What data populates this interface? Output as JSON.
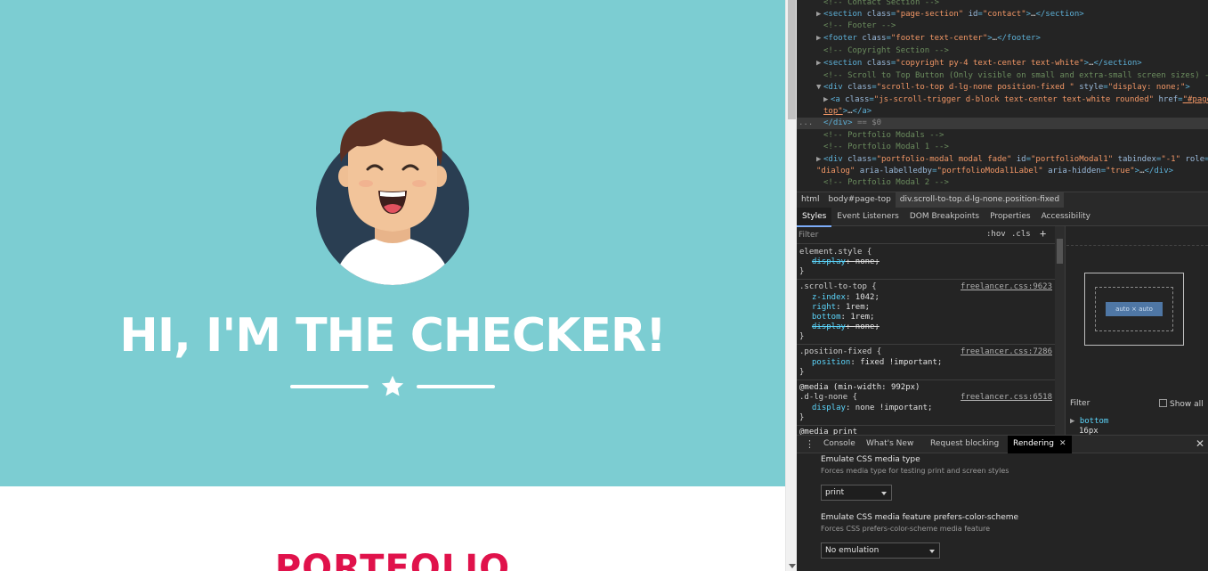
{
  "page": {
    "hero_title": "HI, I'M THE CHECKER!",
    "portfolio_heading": "PORTFOLIO",
    "colors": {
      "masthead": "#7ccdd2",
      "accent": "#e0124b",
      "white": "#ffffff"
    }
  },
  "devtools": {
    "dom": [
      {
        "comment": "<!-- Contact Section -->"
      },
      {
        "tag": "section",
        "attrs": [
          [
            "class",
            "page-section"
          ],
          [
            "id",
            "contact"
          ]
        ],
        "collapsed": "…</section>"
      },
      {
        "comment": "<!-- Footer -->"
      },
      {
        "tag": "footer",
        "attrs": [
          [
            "class",
            "footer text-center"
          ]
        ],
        "collapsed": "…</footer>"
      },
      {
        "comment": "<!-- Copyright Section -->"
      },
      {
        "tag": "section",
        "attrs": [
          [
            "class",
            "copyright py-4 text-center text-white"
          ]
        ],
        "collapsed": "…</section>"
      },
      {
        "comment": "<!-- Scroll to Top Button (Only visible on small and extra-small screen sizes) -->"
      },
      {
        "tag": "div",
        "attrs": [
          [
            "class",
            "scroll-to-top d-lg-none position-fixed "
          ],
          [
            "style",
            "display: none;"
          ]
        ],
        "open": true
      },
      {
        "tag_a_line1": "<a class=\"js-scroll-trigger d-block text-center text-white rounded\" href=\"#page-",
        "tag_a_line2": "top\">…</a>"
      },
      {
        "close": "</div>",
        "marker": "== $0"
      },
      {
        "comment": "<!-- Portfolio Modals -->"
      },
      {
        "comment": "<!-- Portfolio Modal 1 -->"
      },
      {
        "modal_line1": "<div class=\"portfolio-modal modal fade\" id=\"portfolioModal1\" tabindex=\"-1\" role=",
        "modal_line2": "\"dialog\" aria-labelledby=\"portfolioModal1Label\" aria-hidden=\"true\">…</div>"
      },
      {
        "comment": "<!-- Portfolio Modal 2 -->"
      }
    ],
    "dom_text": {
      "l0": "<!-- Contact Section -->",
      "l2": "<!-- Footer -->",
      "l4": "<!-- Copyright Section -->",
      "l6": "<!-- Scroll to Top Button (Only visible on small and extra-small screen sizes) -->",
      "l10": "<!-- Portfolio Modals -->",
      "l11": "<!-- Portfolio Modal 1 -->",
      "l13": "<!-- Portfolio Modal 2 -->",
      "close_div": "</div>",
      "marker": "== $0",
      "ellipsis": "..."
    },
    "breadcrumbs": [
      "html",
      "body#page-top",
      "div.scroll-to-top.d-lg-none.position-fixed"
    ],
    "subtabs": [
      "Styles",
      "Event Listeners",
      "DOM Breakpoints",
      "Properties",
      "Accessibility"
    ],
    "styles": {
      "filter_placeholder": "Filter",
      "hov": ":hov",
      "cls": ".cls",
      "plus": "+",
      "element_style": "element.style {",
      "rules": [
        {
          "selector": ".scroll-to-top {",
          "source": "freelancer.css:9623"
        },
        {
          "selector": ".position-fixed {",
          "source": "freelancer.css:7286"
        },
        {
          "selector": ".d-lg-none {",
          "source": "freelancer.css:6518"
        }
      ],
      "media_992": "@media (min-width: 992px)",
      "media_print": "@media print",
      "close_brace": "}",
      "decl": {
        "display_none": [
          "display",
          "none;"
        ],
        "z_index": [
          "z-index",
          "1042;"
        ],
        "right": [
          "right",
          "1rem;"
        ],
        "bottom": [
          "bottom",
          "1rem;"
        ],
        "display_none2": [
          "display",
          "none;"
        ],
        "position": [
          "position",
          "fixed !important;"
        ],
        "display_imp": [
          "display",
          "none !important;"
        ]
      }
    },
    "computed": {
      "boxmodel_content": "auto × auto",
      "filter": "Filter",
      "show_all": "Show all",
      "prop": "bottom",
      "value": "16px"
    },
    "drawer": {
      "tabs": [
        "Console",
        "What's New",
        "Request blocking",
        "Rendering"
      ],
      "active_tab": "Rendering",
      "media_title": "Emulate CSS media type",
      "media_desc": "Forces media type for testing print and screen styles",
      "media_value": "print",
      "scheme_title": "Emulate CSS media feature prefers-color-scheme",
      "scheme_desc": "Forces CSS prefers-color-scheme media feature",
      "scheme_value": "No emulation"
    }
  }
}
